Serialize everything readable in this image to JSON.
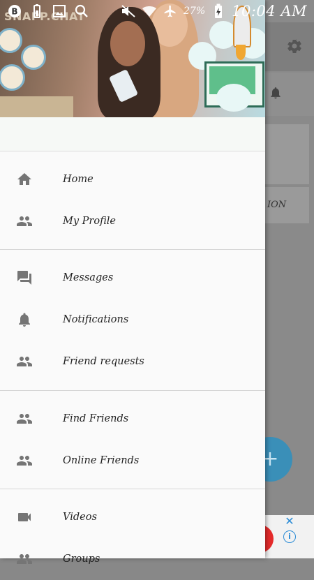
{
  "status_bar": {
    "battery": "27%",
    "time": "10:04 AM",
    "icons": [
      "b-circle-icon",
      "battery-saver-icon",
      "image-icon",
      "search-icon",
      "mute-icon",
      "wifi-icon",
      "airplane-mode-icon",
      "battery-charging-icon"
    ]
  },
  "drawer": {
    "header": {
      "logo_text": "SNAPP.CHAT"
    },
    "sections": [
      {
        "items": [
          {
            "label": "Home",
            "icon": "home-icon"
          },
          {
            "label": "My Profile",
            "icon": "people-icon"
          }
        ]
      },
      {
        "items": [
          {
            "label": "Messages",
            "icon": "chat-icon"
          },
          {
            "label": "Notifications",
            "icon": "bell-icon"
          },
          {
            "label": "Friend requests",
            "icon": "people-icon"
          }
        ]
      },
      {
        "items": [
          {
            "label": "Find Friends",
            "icon": "people-icon"
          },
          {
            "label": "Online Friends",
            "icon": "people-icon"
          }
        ]
      },
      {
        "items": [
          {
            "label": "Videos",
            "icon": "video-icon"
          },
          {
            "label": "Groups",
            "icon": "people-icon"
          }
        ]
      }
    ]
  },
  "background": {
    "card_text": "ION",
    "fab_symbol": "+",
    "ad_close": "✕",
    "ad_info": "i"
  },
  "colors": {
    "drawer_bg": "#fafafa",
    "icon_gray": "#757575",
    "fab": "#3a8fb8",
    "ad_accent": "#2b8cd6"
  }
}
